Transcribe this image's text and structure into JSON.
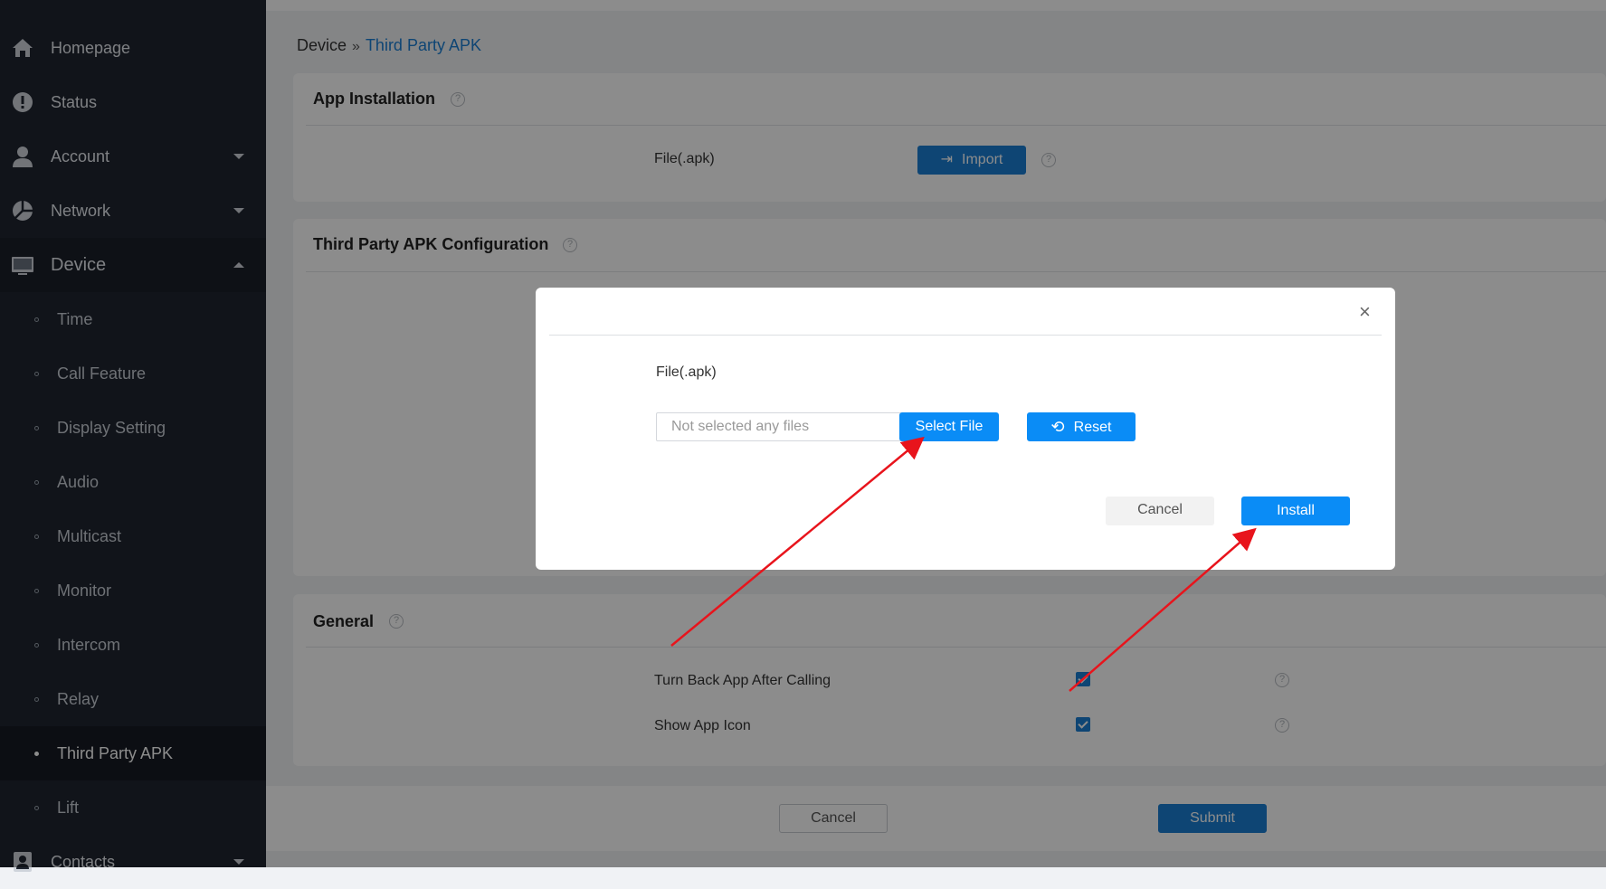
{
  "sidebar": {
    "items": [
      {
        "label": "Homepage",
        "icon": "home-icon"
      },
      {
        "label": "Status",
        "icon": "status-icon"
      },
      {
        "label": "Account",
        "icon": "user-icon"
      },
      {
        "label": "Network",
        "icon": "network-icon"
      },
      {
        "label": "Device",
        "icon": "device-icon"
      },
      {
        "label": "Contacts",
        "icon": "contacts-icon"
      }
    ],
    "device_sub": [
      "Time",
      "Call Feature",
      "Display Setting",
      "Audio",
      "Multicast",
      "Monitor",
      "Intercom",
      "Relay",
      "Third Party APK",
      "Lift"
    ]
  },
  "breadcrumb": {
    "parent": "Device",
    "separator": "»",
    "current": "Third Party APK"
  },
  "app_installation": {
    "title": "App Installation",
    "file_label": "File(.apk)",
    "import_label": "Import"
  },
  "config": {
    "title": "Third Party APK Configuration"
  },
  "general": {
    "title": "General",
    "turn_back_label": "Turn Back App After Calling",
    "show_icon_label": "Show App Icon"
  },
  "footer": {
    "cancel_label": "Cancel",
    "submit_label": "Submit"
  },
  "modal": {
    "close": "×",
    "file_label": "File(.apk)",
    "file_placeholder": "Not selected any files",
    "select_label": "Select File",
    "reset_label": "Reset",
    "cancel_label": "Cancel",
    "install_label": "Install"
  },
  "help_glyph": "?",
  "colors": {
    "primary": "#0a8cf6",
    "sidebar": "#1f2530",
    "arrow": "#e8141c"
  }
}
